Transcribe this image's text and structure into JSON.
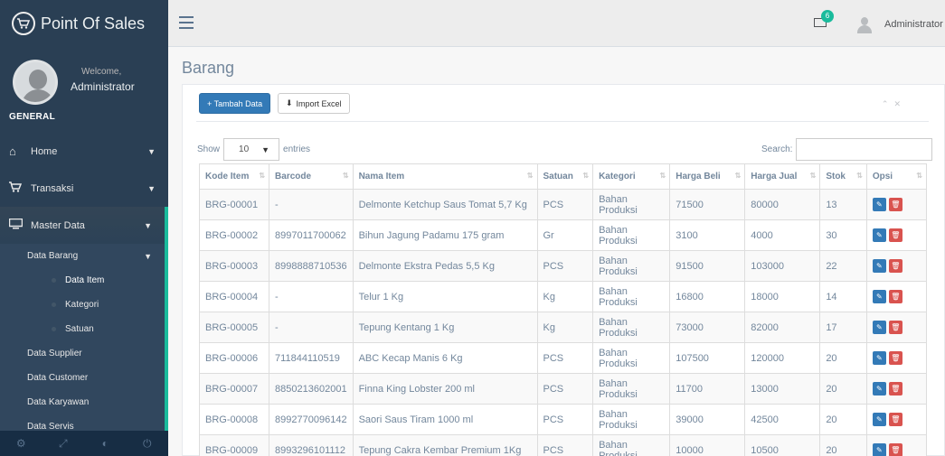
{
  "app": {
    "brand": "Point Of Sales"
  },
  "profile": {
    "welcome": "Welcome,",
    "name": "Administrator"
  },
  "sidebar": {
    "section": "GENERAL",
    "items": [
      {
        "label": "Home"
      },
      {
        "label": "Transaksi"
      },
      {
        "label": "Master Data"
      }
    ],
    "submenu": [
      {
        "label": "Data Barang"
      },
      {
        "label": "Data Item"
      },
      {
        "label": "Kategori"
      },
      {
        "label": "Satuan"
      },
      {
        "label": "Data Supplier"
      },
      {
        "label": "Data Customer"
      },
      {
        "label": "Data Karyawan"
      },
      {
        "label": "Data Servis"
      }
    ]
  },
  "topnav": {
    "mail_count": "6",
    "user": "Administrator"
  },
  "page": {
    "title": "Barang"
  },
  "toolbar": {
    "add_label": "+ Tambah Data",
    "import_label": "Import Excel"
  },
  "table_controls": {
    "show": "Show",
    "entries_value": "10",
    "entries": "entries",
    "search": "Search:"
  },
  "table": {
    "headers": [
      "Kode Item",
      "Barcode",
      "Nama Item",
      "Satuan",
      "Kategori",
      "Harga Beli",
      "Harga Jual",
      "Stok",
      "Opsi"
    ],
    "rows": [
      [
        "BRG-00001",
        "-",
        "Delmonte Ketchup Saus Tomat 5,7 Kg",
        "PCS",
        "Bahan Produksi",
        "71500",
        "80000",
        "13"
      ],
      [
        "BRG-00002",
        "8997011700062",
        "Bihun Jagung Padamu 175 gram",
        "Gr",
        "Bahan Produksi",
        "3100",
        "4000",
        "30"
      ],
      [
        "BRG-00003",
        "8998888710536",
        "Delmonte Ekstra Pedas 5,5 Kg",
        "PCS",
        "Bahan Produksi",
        "91500",
        "103000",
        "22"
      ],
      [
        "BRG-00004",
        "-",
        "Telur 1 Kg",
        "Kg",
        "Bahan Produksi",
        "16800",
        "18000",
        "14"
      ],
      [
        "BRG-00005",
        "-",
        "Tepung Kentang 1 Kg",
        "Kg",
        "Bahan Produksi",
        "73000",
        "82000",
        "17"
      ],
      [
        "BRG-00006",
        "711844110519",
        "ABC Kecap Manis 6 Kg",
        "PCS",
        "Bahan Produksi",
        "107500",
        "120000",
        "20"
      ],
      [
        "BRG-00007",
        "8850213602001",
        "Finna King Lobster 200 ml",
        "PCS",
        "Bahan Produksi",
        "11700",
        "13000",
        "20"
      ],
      [
        "BRG-00008",
        "8992770096142",
        "Saori Saus Tiram 1000 ml",
        "PCS",
        "Bahan Produksi",
        "39000",
        "42500",
        "20"
      ],
      [
        "BRG-00009",
        "8993296101112",
        "Tepung Cakra Kembar Premium 1Kg",
        "PCS",
        "Bahan Produksi",
        "10000",
        "10500",
        "20"
      ]
    ]
  }
}
